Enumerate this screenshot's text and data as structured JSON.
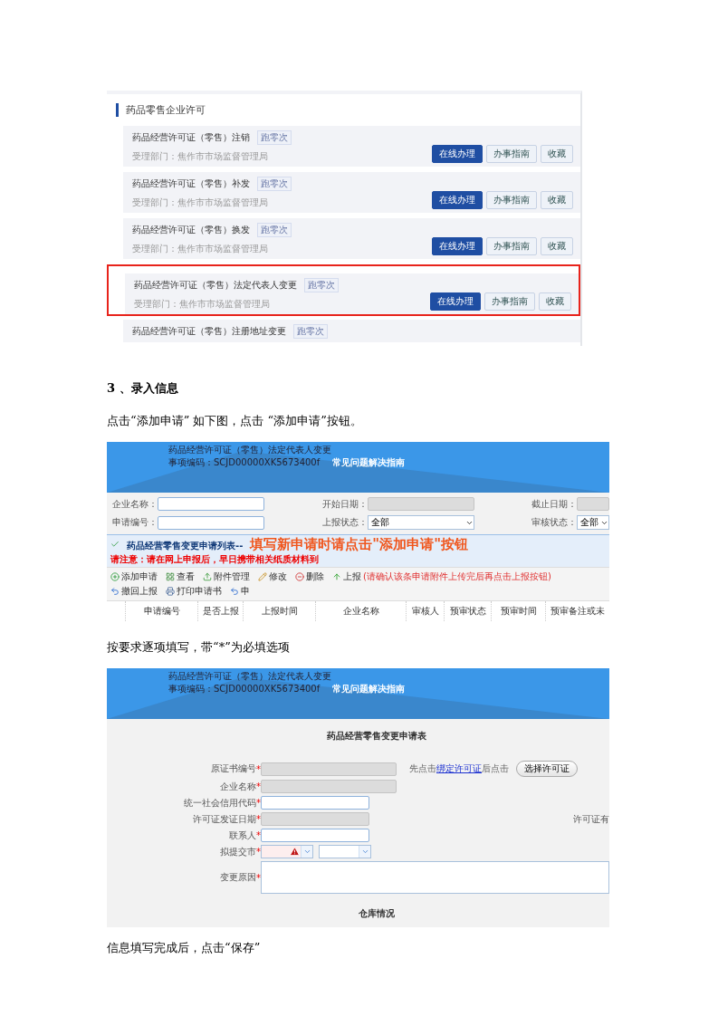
{
  "permit_list": {
    "title": "药品零售企业许可",
    "items": [
      {
        "title": "药品经营许可证（零售）注销",
        "tag": "跑零次",
        "dept": "受理部门：焦作市市场监督管理局",
        "buttons": [
          "在线办理",
          "办事指南",
          "收藏"
        ],
        "highlighted": false
      },
      {
        "title": "药品经营许可证（零售）补发",
        "tag": "跑零次",
        "dept": "受理部门：焦作市市场监督管理局",
        "buttons": [
          "在线办理",
          "办事指南",
          "收藏"
        ],
        "highlighted": false
      },
      {
        "title": "药品经营许可证（零售）换发",
        "tag": "跑零次",
        "dept": "受理部门：焦作市市场监督管理局",
        "buttons": [
          "在线办理",
          "办事指南",
          "收藏"
        ],
        "highlighted": false
      },
      {
        "title": "药品经营许可证（零售）法定代表人变更",
        "tag": "跑零次",
        "dept": "受理部门：焦作市市场监督管理局",
        "buttons": [
          "在线办理",
          "办事指南",
          "收藏"
        ],
        "highlighted": true
      },
      {
        "title": "药品经营许可证（零售）注册地址变更",
        "tag": "跑零次",
        "highlighted": false
      }
    ]
  },
  "heading": "3 、录入信息",
  "para_1": "点击“添加申请” 如下图，点击 “添加申请”按钮。",
  "list_screen": {
    "banner": {
      "title": "药品经营许可证（零售）法定代表人变更",
      "code": "事项编码：SCJD00000XK5673400f",
      "link": "常见问题解决指南"
    },
    "filters": [
      {
        "label": "企业名称：",
        "kind": "input",
        "disabled": false
      },
      {
        "label": "开始日期：",
        "kind": "input",
        "disabled": true
      },
      {
        "label": "截止日期：",
        "kind": "input",
        "disabled": true
      },
      {
        "label": "申请编号：",
        "kind": "input",
        "disabled": false
      },
      {
        "label": "上报状态：",
        "kind": "select",
        "value": "全部"
      },
      {
        "label": "审核状态：",
        "kind": "select",
        "value": "全部"
      }
    ],
    "list_title": "药品经营零售变更申请列表--",
    "callout": "填写新申请时请点击\"添加申请\"按钮",
    "notice": "请注意：请在网上申报后，早日携带相关纸质材料到",
    "toolbar": [
      {
        "label": "添加申请",
        "kind": "add"
      },
      {
        "label": "查看",
        "kind": "view"
      },
      {
        "label": "附件管理",
        "kind": "attach"
      },
      {
        "label": "修改",
        "kind": "edit"
      },
      {
        "label": "删除",
        "kind": "delete"
      },
      {
        "label": "上报",
        "kind": "submit",
        "note": "(请确认该条申请附件上传完后再点击上报按钮)"
      },
      {
        "label": "撤回上报",
        "kind": "withdraw"
      },
      {
        "label": "打印申请书",
        "kind": "print"
      },
      {
        "label": "申",
        "kind": "withdraw"
      }
    ],
    "columns": [
      "申请编号",
      "是否上报",
      "上报时间",
      "企业名称",
      "审核人",
      "预审状态",
      "预审时间",
      "预审备注或未"
    ]
  },
  "para_2": "按要求逐项填写，带“*”为必填选项",
  "form_screen": {
    "banner": {
      "title": "药品经营许可证（零售）法定代表人变更",
      "code": "事项编码：SCJD00000XK5673400f",
      "link": "常见问题解决指南"
    },
    "form_title": "药品经营零售变更申请表",
    "fields": [
      {
        "label": "原证书编号",
        "mark": "*",
        "kind": "wide_input",
        "disabled": true,
        "hint": {
          "before": "先点击",
          "link": "绑定许可证",
          "after": "后点击",
          "button": "选择许可证"
        }
      },
      {
        "label": "企业名称",
        "mark": "*",
        "kind": "wide_input",
        "disabled": true
      },
      {
        "label": "统一社会信用代码",
        "mark": "*",
        "kind": "input",
        "disabled": false
      },
      {
        "label": "许可证发证日期",
        "mark": "*",
        "kind": "input",
        "disabled": true,
        "side_label": "许可证有"
      },
      {
        "label": "联系人",
        "mark": "*",
        "kind": "input",
        "disabled": false
      },
      {
        "label": "拟提交市",
        "mark": "*",
        "kind": "selects",
        "invalid": true
      },
      {
        "label": "变更原因",
        "mark": "*",
        "kind": "textarea"
      }
    ],
    "section": "仓库情况"
  },
  "para_3": "信息填写完成后，点击“保存”"
}
